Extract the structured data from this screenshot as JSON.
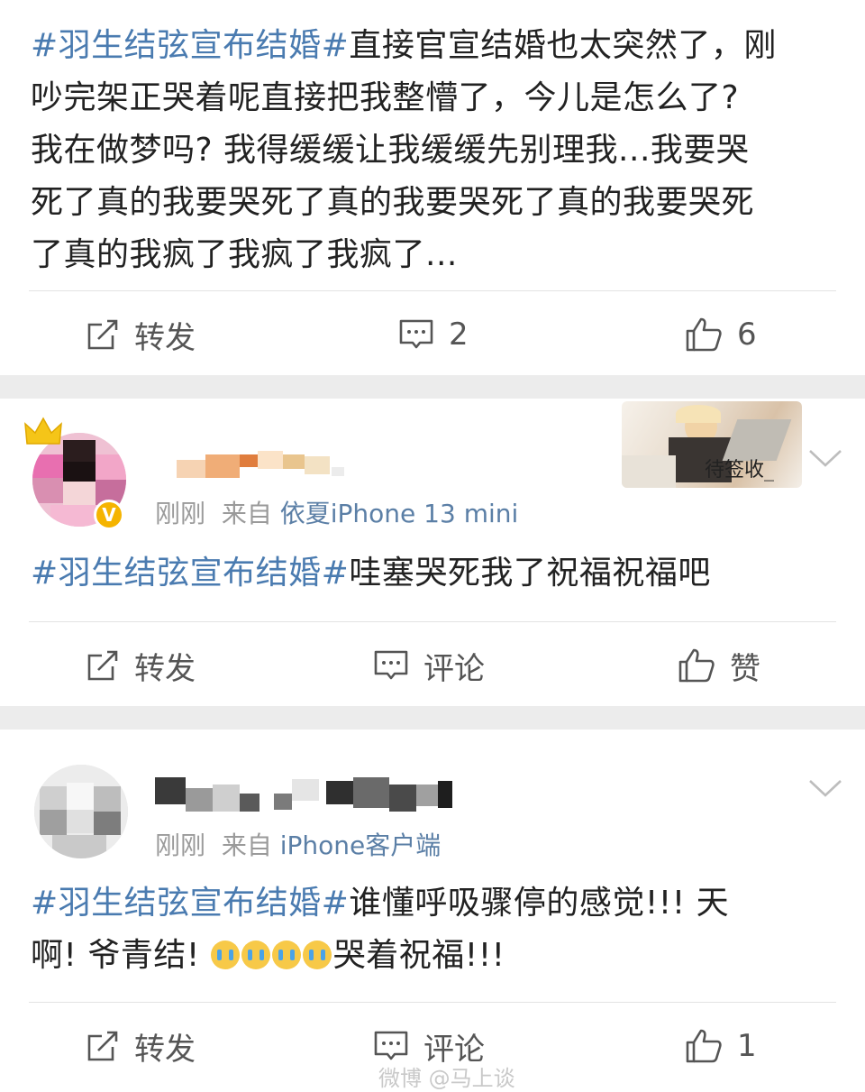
{
  "post1": {
    "topic": "#羽生结弦宣布结婚#",
    "lines": [
      "直接官宣结婚也太突然了，刚",
      "吵完架正哭着呢直接把我整懵了，今儿是怎么了?",
      "我在做梦吗? 我得缓缓让我缓缓先别理我...我要哭",
      "死了真的我要哭死了真的我要哭死了真的我要哭死",
      "了真的我疯了我疯了我疯了..."
    ],
    "repost_label": "转发",
    "comment_count": "2",
    "like_count": "6"
  },
  "post2": {
    "time": "刚刚",
    "from_label": "来自",
    "source": "依夏iPhone 13 mini",
    "badge_label": "待签收_",
    "topic": "#羽生结弦宣布结婚#",
    "text": "哇塞哭死我了祝福祝福吧",
    "repost_label": "转发",
    "comment_label": "评论",
    "like_label": "赞"
  },
  "post3": {
    "time": "刚刚",
    "from_label": "来自",
    "source": "iPhone客户端",
    "topic": "#羽生结弦宣布结婚#",
    "line1": "谁懂呼吸骤停的感觉!!! 天",
    "line2_start": "啊! 爷青结!",
    "line2_end": "哭着祝福!!!",
    "repost_label": "转发",
    "comment_label": "评论",
    "like_count": "1"
  },
  "watermark": "微博 @马上谈",
  "colors": {
    "topic": "#4a7bb0",
    "separator": "#ececec",
    "meta": "#9a9a9a",
    "source": "#5b7fa6"
  }
}
